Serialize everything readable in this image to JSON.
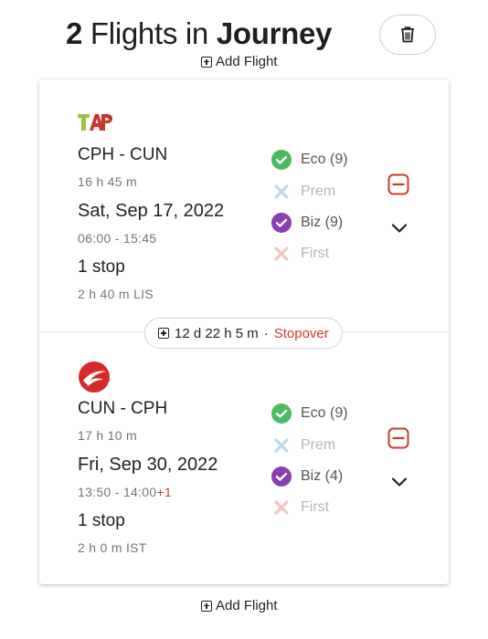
{
  "header": {
    "count": "2",
    "middle": " Flights in ",
    "bold": "Journey"
  },
  "add_flight_label": "Add Flight",
  "stopover": {
    "duration": "12 d 22 h 5 m",
    "separator": "·",
    "label": "Stopover"
  },
  "segments": [
    {
      "airline_logo": "TAP",
      "route": "CPH - CUN",
      "duration": "16 h 45 m",
      "date": "Sat, Sep 17, 2022",
      "times": "06:00 - 15:45",
      "day_offset": "",
      "stops": "1 stop",
      "layover": "2 h 40 m LIS",
      "cabins": [
        {
          "label": "Eco (9)",
          "state": "available"
        },
        {
          "label": "Prem",
          "state": "unavailable"
        },
        {
          "label": "Biz (9)",
          "state": "available"
        },
        {
          "label": "First",
          "state": "unavailable"
        }
      ]
    },
    {
      "airline_logo": "turkish-airlines-logo",
      "route": "CUN - CPH",
      "duration": "17 h 10 m",
      "date": "Fri, Sep 30, 2022",
      "times": "13:50 - 14:00",
      "day_offset": "+1",
      "stops": "1 stop",
      "layover": "2 h 0 m IST",
      "cabins": [
        {
          "label": "Eco (9)",
          "state": "available"
        },
        {
          "label": "Prem",
          "state": "unavailable"
        },
        {
          "label": "Biz (4)",
          "state": "available"
        },
        {
          "label": "First",
          "state": "unavailable"
        }
      ]
    }
  ],
  "colors": {
    "eco_check": "#4cb963",
    "biz_check": "#8a3fb0",
    "prem_x": "#bcd8ee",
    "first_x": "#f2c6c0",
    "accent_red": "#cc3b2d"
  }
}
